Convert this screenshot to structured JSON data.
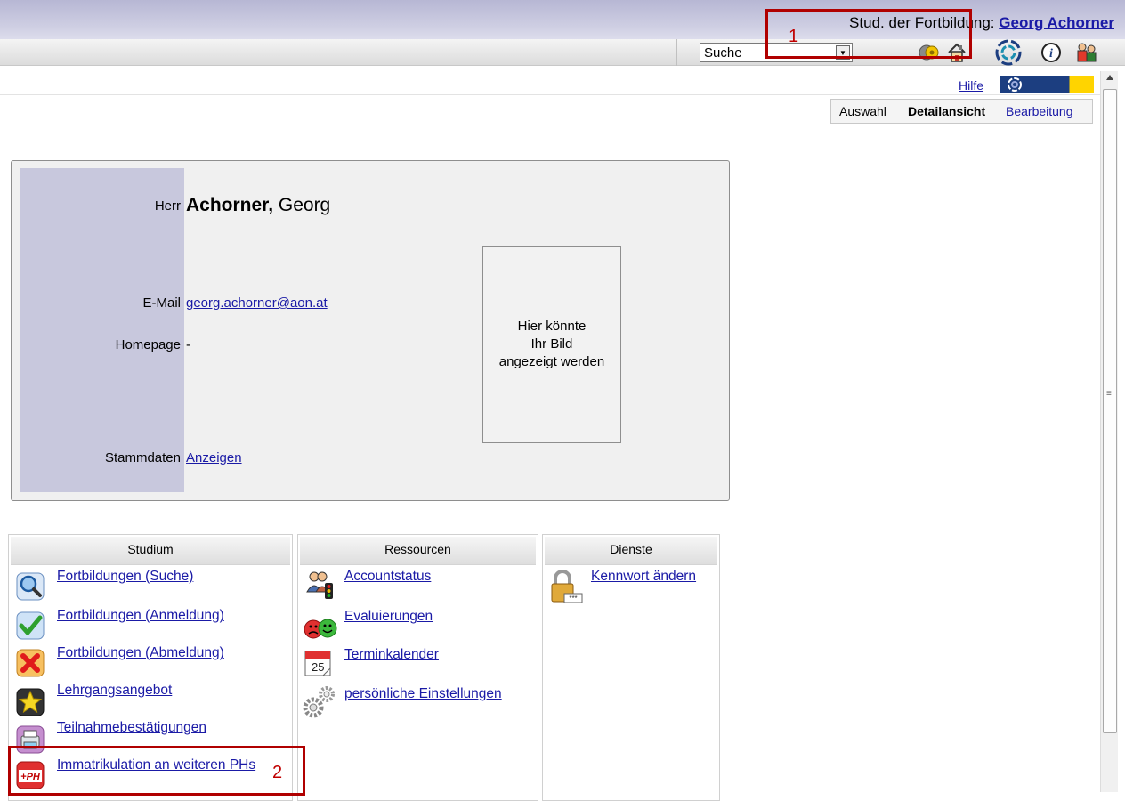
{
  "header": {
    "role": "Stud. der Fortbildung:",
    "user_name": "Georg Achorner",
    "search_value": "Suche"
  },
  "topnav": {
    "hilfe": "Hilfe"
  },
  "view_tabs": {
    "auswahl": "Auswahl",
    "detailansicht": "Detailansicht",
    "bearbeitung": "Bearbeitung"
  },
  "profile": {
    "salutation": "Herr",
    "last_name": "Achorner,",
    "first_name": "Georg",
    "email_label": "E-Mail",
    "email": "georg.achorner@aon.at",
    "homepage_label": "Homepage",
    "homepage": "-",
    "stammdaten_label": "Stammdaten",
    "stammdaten_link": "Anzeigen",
    "photo_line1": "Hier könnte",
    "photo_line2": "Ihr Bild",
    "photo_line3": "angezeigt werden"
  },
  "studium": {
    "title": "Studium",
    "items": [
      "Fortbildungen (Suche)",
      "Fortbildungen (Anmeldung)",
      "Fortbildungen (Abmeldung)",
      "Lehrgangsangebot",
      "Teilnahmebestätigungen",
      "Immatrikulation an weiteren PHs"
    ]
  },
  "ressourcen": {
    "title": "Ressourcen",
    "items": [
      "Accountstatus",
      "Evaluierungen",
      "Terminkalender",
      "persönliche Einstellungen"
    ],
    "calendar_day": "25"
  },
  "dienste": {
    "title": "Dienste",
    "items": [
      "Kennwort ändern"
    ]
  },
  "annotations": {
    "marker1": "1",
    "marker2": "2"
  },
  "icons": {
    "toolbar": [
      "coins-key-icon",
      "home-icon",
      "portal-logo-icon",
      "info-icon",
      "people-icon"
    ],
    "studium": [
      "magnifier-icon",
      "checkmark-icon",
      "red-x-icon",
      "star-icon",
      "printer-icon",
      "plus-ph-icon"
    ],
    "ressourcen": [
      "users-traffic-light-icon",
      "smileys-icon",
      "calendar-icon",
      "gears-icon"
    ],
    "dienste": [
      "padlock-password-icon"
    ]
  },
  "colors": {
    "link": "#1a1aa6",
    "highlight_box": "#b00000",
    "label_column": "#c8c8dd",
    "brand_blue": "#1c3e80",
    "brand_yellow": "#ffd400"
  }
}
